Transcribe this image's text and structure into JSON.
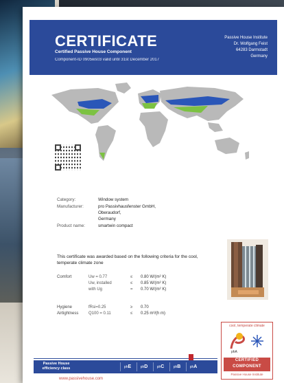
{
  "certificate": {
    "title": "CERTIFICATE",
    "subtitle": "Certified Passive House Component",
    "component_id": "Component-ID 0905ws03 valid until 31st December 2017",
    "institute_lines": [
      "Passive House Institute",
      "Dr. Wolfgang Feist",
      "64283 Darmstadt",
      "Germany"
    ]
  },
  "info": {
    "category_label": "Category:",
    "category_value": "Window system",
    "manufacturer_label": "Manufacturer:",
    "manufacturer_lines": [
      "pro Passivhausfenster GmbH,",
      "Oberaudorf,",
      "Germany"
    ],
    "product_label": "Product name:",
    "product_value": "smartwin compact"
  },
  "awarded_text": "This certificate was awarded based on the following criteria for the cool, temperate climate zone",
  "criteria": {
    "comfort_label": "Comfort",
    "comfort_rows": [
      {
        "formula": "Uw = 0.77",
        "op": "≤",
        "value": "0.80 W/(m² K)"
      },
      {
        "formula": "Uw, installed",
        "op": "≤",
        "value": "0.85 W/(m² K)"
      },
      {
        "formula": "with  Ug",
        "op": "=",
        "value": "0.70 W/(m² K)"
      }
    ],
    "hygiene_label": "Hygiene",
    "hygiene_formula": "fRsi=0.25",
    "hygiene_op": "≥",
    "hygiene_value": "0.70",
    "airtight_label": "Airtightness",
    "airtight_formula": "Q100 = 0.11",
    "airtight_op": "≤",
    "airtight_value": "0.25 m³/(h m)"
  },
  "badge": {
    "top": "cool, temperate climate",
    "pha": "phA",
    "mid_lines": [
      "CERTIFIED",
      "COMPONENT"
    ],
    "bottom": "Passive House Institute"
  },
  "efficiency": {
    "label_lines": [
      "Passive House",
      "efficiency class"
    ],
    "classes": [
      {
        "prefix": "ph",
        "letter": "E"
      },
      {
        "prefix": "ph",
        "letter": "D"
      },
      {
        "prefix": "ph",
        "letter": "C"
      },
      {
        "prefix": "ph",
        "letter": "B"
      },
      {
        "prefix": "ph",
        "letter": "A"
      }
    ],
    "active": "A"
  },
  "website": "www.passivehouse.com",
  "colors": {
    "brand_blue": "#2b4a9a",
    "badge_red": "#c94b45",
    "zone_green": "#7cc242",
    "zone_blue": "#2a56b8"
  }
}
